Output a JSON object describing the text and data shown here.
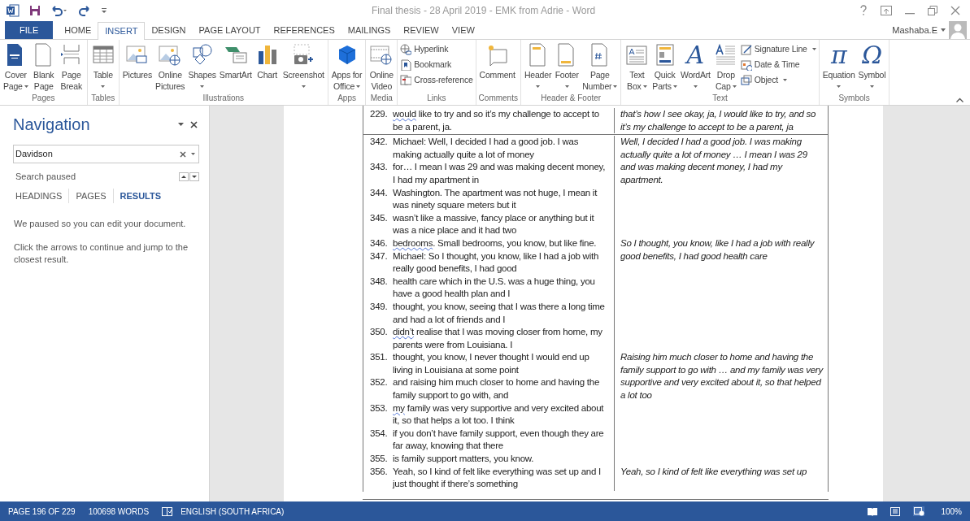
{
  "window": {
    "title": "Final thesis - 28 April 2019 - EMK from Adrie - Word"
  },
  "ribbon_tabs": [
    {
      "label": "FILE",
      "kind": "file",
      "selected": false
    },
    {
      "label": "HOME",
      "kind": "tab",
      "selected": false
    },
    {
      "label": "INSERT",
      "kind": "tab",
      "selected": true
    },
    {
      "label": "DESIGN",
      "kind": "tab",
      "selected": false
    },
    {
      "label": "PAGE LAYOUT",
      "kind": "tab",
      "selected": false
    },
    {
      "label": "REFERENCES",
      "kind": "tab",
      "selected": false
    },
    {
      "label": "MAILINGS",
      "kind": "tab",
      "selected": false
    },
    {
      "label": "REVIEW",
      "kind": "tab",
      "selected": false
    },
    {
      "label": "VIEW",
      "kind": "tab",
      "selected": false
    }
  ],
  "user": {
    "name": "Mashaba.E"
  },
  "ribbon_groups": [
    {
      "label": "Pages",
      "items": [
        {
          "kind": "large",
          "lines": [
            "Cover",
            "Page"
          ],
          "dropdown": true
        },
        {
          "kind": "large",
          "lines": [
            "Blank",
            "Page"
          ],
          "dropdown": false
        },
        {
          "kind": "large",
          "lines": [
            "Page",
            "Break"
          ],
          "dropdown": false
        }
      ]
    },
    {
      "label": "Tables",
      "items": [
        {
          "kind": "large",
          "lines": [
            "Table"
          ],
          "dropdown": true
        }
      ]
    },
    {
      "label": "Illustrations",
      "items": [
        {
          "kind": "large",
          "lines": [
            "Pictures"
          ],
          "dropdown": false
        },
        {
          "kind": "large",
          "lines": [
            "Online",
            "Pictures"
          ],
          "dropdown": false
        },
        {
          "kind": "large",
          "lines": [
            "Shapes"
          ],
          "dropdown": true
        },
        {
          "kind": "large",
          "lines": [
            "SmartArt"
          ],
          "dropdown": false
        },
        {
          "kind": "large",
          "lines": [
            "Chart"
          ],
          "dropdown": false
        },
        {
          "kind": "large",
          "lines": [
            "Screenshot"
          ],
          "dropdown": true
        }
      ]
    },
    {
      "label": "Apps",
      "items": [
        {
          "kind": "large",
          "lines": [
            "Apps for",
            "Office"
          ],
          "dropdown": true
        }
      ]
    },
    {
      "label": "Media",
      "items": [
        {
          "kind": "large",
          "lines": [
            "Online",
            "Video"
          ],
          "dropdown": false
        }
      ]
    },
    {
      "label": "Links",
      "items": [
        {
          "kind": "small",
          "lines": [
            "Hyperlink"
          ],
          "dropdown": false
        },
        {
          "kind": "small",
          "lines": [
            "Bookmark"
          ],
          "dropdown": false
        },
        {
          "kind": "small",
          "lines": [
            "Cross-reference"
          ],
          "dropdown": false
        }
      ]
    },
    {
      "label": "Comments",
      "items": [
        {
          "kind": "large",
          "lines": [
            "Comment"
          ],
          "dropdown": false
        }
      ]
    },
    {
      "label": "Header & Footer",
      "items": [
        {
          "kind": "large",
          "lines": [
            "Header"
          ],
          "dropdown": true
        },
        {
          "kind": "large",
          "lines": [
            "Footer"
          ],
          "dropdown": true
        },
        {
          "kind": "large",
          "lines": [
            "Page",
            "Number"
          ],
          "dropdown": true
        }
      ]
    },
    {
      "label": "Text",
      "items": [
        {
          "kind": "large",
          "lines": [
            "Text",
            "Box"
          ],
          "dropdown": true
        },
        {
          "kind": "large",
          "lines": [
            "Quick",
            "Parts"
          ],
          "dropdown": true
        },
        {
          "kind": "large",
          "lines": [
            "WordArt"
          ],
          "dropdown": true,
          "glyph": "A"
        },
        {
          "kind": "large",
          "lines": [
            "Drop",
            "Cap"
          ],
          "dropdown": true
        },
        {
          "kind": "small",
          "lines": [
            "Signature Line"
          ],
          "dropdown": true
        },
        {
          "kind": "small",
          "lines": [
            "Date & Time"
          ],
          "dropdown": false
        },
        {
          "kind": "small",
          "lines": [
            "Object"
          ],
          "dropdown": true
        }
      ]
    },
    {
      "label": "Symbols",
      "items": [
        {
          "kind": "large",
          "lines": [
            "Equation"
          ],
          "dropdown": true,
          "glyph": "π"
        },
        {
          "kind": "large",
          "lines": [
            "Symbol"
          ],
          "dropdown": true,
          "glyph": "Ω"
        }
      ]
    }
  ],
  "navigation": {
    "title": "Navigation",
    "search": {
      "value": "Davidson"
    },
    "status": "Search paused",
    "tabs": [
      {
        "label": "HEADINGS",
        "selected": false
      },
      {
        "label": "PAGES",
        "selected": false
      },
      {
        "label": "RESULTS",
        "selected": true
      }
    ],
    "messages": [
      "We paused so you can edit your document.",
      "Click the arrows to continue and jump to the closest result."
    ]
  },
  "document": {
    "rows": [
      {
        "segments": [
          {
            "lines": [
              {
                "num": "229.",
                "flagged": "would",
                "text": " like to try and so it’s my challenge to accept to be a parent, ja."
              }
            ],
            "note": "that’s how I see okay, ja, I would like to try, and so it’s my challenge to accept to be a parent, ja"
          }
        ]
      },
      {
        "segments": [
          {
            "lines": [
              {
                "num": "342.",
                "text": "Michael: Well, I decided I had a good job. I was making actually quite a lot of money"
              },
              {
                "num": "343.",
                "text": "for… I mean I was 29 and was making decent money, I had my apartment in"
              },
              {
                "num": "344.",
                "text": "Washington. The apartment was not huge, I mean it was ninety square meters but it"
              },
              {
                "num": "345.",
                "text": "wasn’t like a massive, fancy place or anything but it was a nice place and it had two"
              }
            ],
            "note": "Well, I decided I had a good job. I was making actually quite a lot of money … I mean I was 29 and was making decent money, I had my apartment."
          },
          {
            "lines": [
              {
                "num": "346.",
                "flagged": "bedrooms",
                "text": ". Small bedrooms, you know, but like fine."
              },
              {
                "num": "347.",
                "text": "Michael: So I thought, you know, like I had a job with really good benefits, I had good"
              },
              {
                "num": "348.",
                "text": "health care which in the U.S. was a huge thing, you have a good health plan and I"
              },
              {
                "num": "349.",
                "text": "thought, you know, seeing that I was there a long time and had a lot of friends and I"
              },
              {
                "num": "350.",
                "flagged": "didn’t",
                "text": " realise that I was moving closer from home, my parents were from Louisiana. I"
              }
            ],
            "note": "So I thought, you know, like I had a job with really good benefits, I had good health care"
          },
          {
            "lines": [
              {
                "num": "351.",
                "text": "thought, you know, I never thought I would end up living in Louisiana at some point"
              },
              {
                "num": "352.",
                "text": "and raising him much closer to home and having the family support to go with, and"
              },
              {
                "num": "353.",
                "flagged": "my",
                "text": " family was very supportive and very excited about it, so that helps a lot too. I think"
              },
              {
                "num": "354.",
                "text": "if you don’t have family support, even though they are far away, knowing that there"
              },
              {
                "num": "355.",
                "text": "is family support matters, you know."
              }
            ],
            "note": "Raising him much closer to home and having the family support to go with … and my family was very supportive and very excited about it, so that helped a lot too"
          },
          {
            "lines": [
              {
                "num": "356.",
                "text": "Yeah, so I kind of felt like everything was set up and I just thought if there’s something"
              }
            ],
            "note": "Yeah, so I kind of felt like everything was set up"
          }
        ]
      }
    ]
  },
  "status_bar": {
    "page": "PAGE 196 OF 229",
    "words": "100698 WORDS",
    "language": "ENGLISH (SOUTH AFRICA)",
    "zoom": "100%"
  }
}
